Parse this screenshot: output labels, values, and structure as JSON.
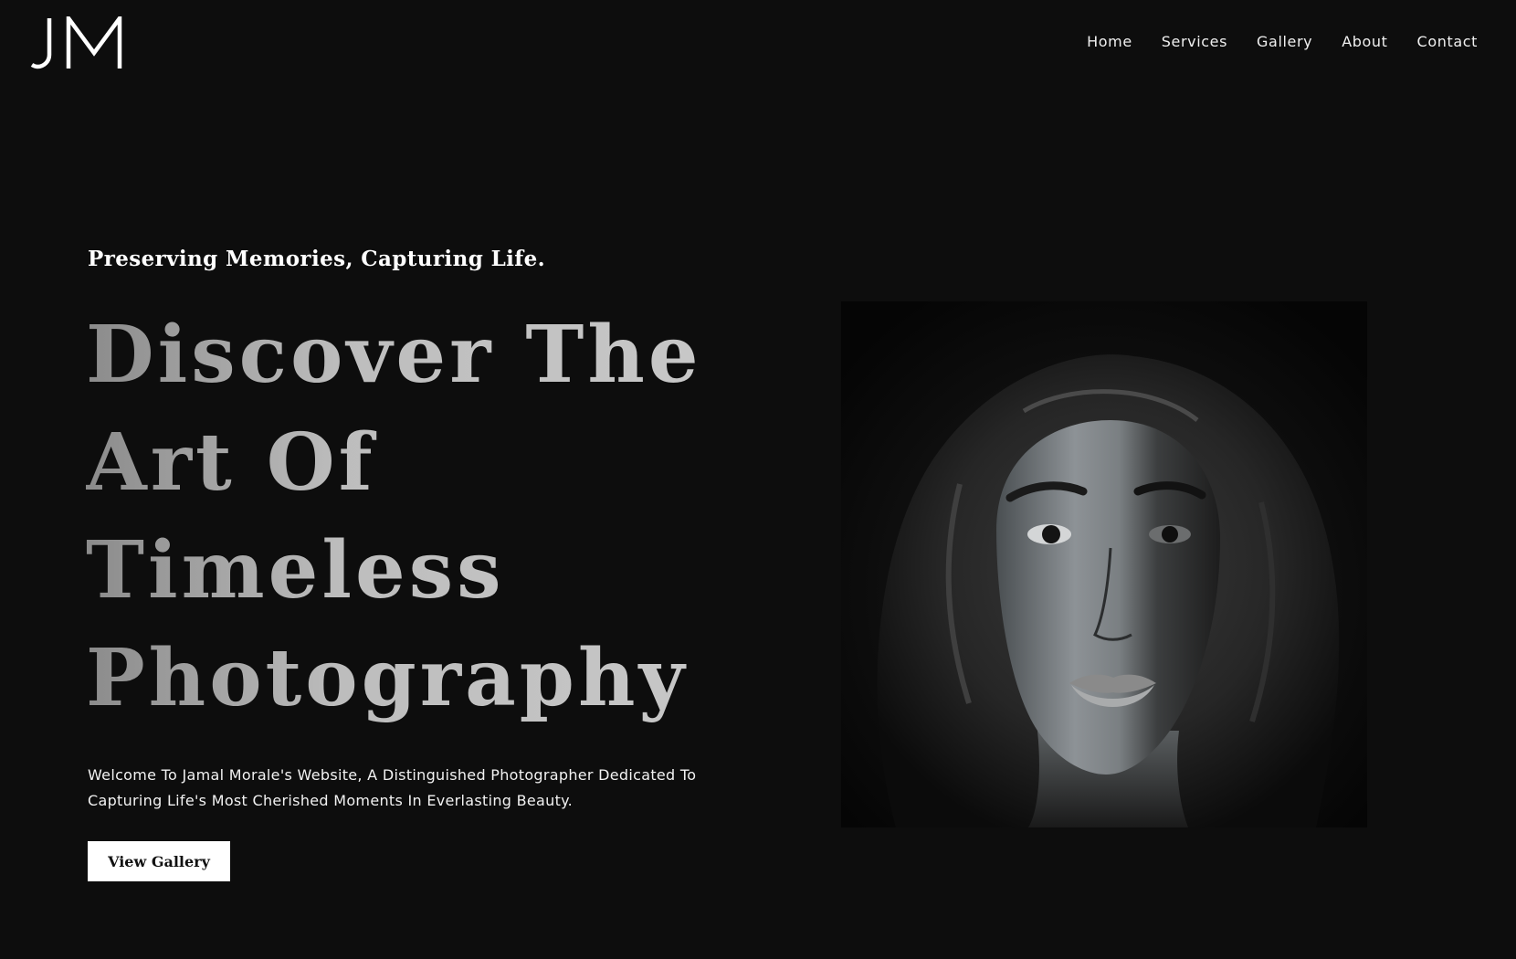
{
  "brand": {
    "logo_text": "JM"
  },
  "nav": {
    "items": [
      {
        "label": "Home"
      },
      {
        "label": "Services"
      },
      {
        "label": "Gallery"
      },
      {
        "label": "About"
      },
      {
        "label": "Contact"
      }
    ]
  },
  "hero": {
    "tagline": "Preserving Memories, Capturing Life.",
    "headline_lines": [
      "Discover The",
      "Art Of",
      "Timeless",
      "Photography"
    ],
    "description": "Welcome To Jamal Morale's Website, A Distinguished Photographer Dedicated To Capturing Life's Most Cherished Moments In Everlasting Beauty.",
    "cta_label": "View Gallery"
  },
  "colors": {
    "background": "#0d0d0d",
    "text": "#ffffff",
    "headline_gradient_start": "#8b8b8b",
    "headline_gradient_end": "#c8c8c8",
    "button_background": "#ffffff",
    "button_text": "#111111"
  }
}
